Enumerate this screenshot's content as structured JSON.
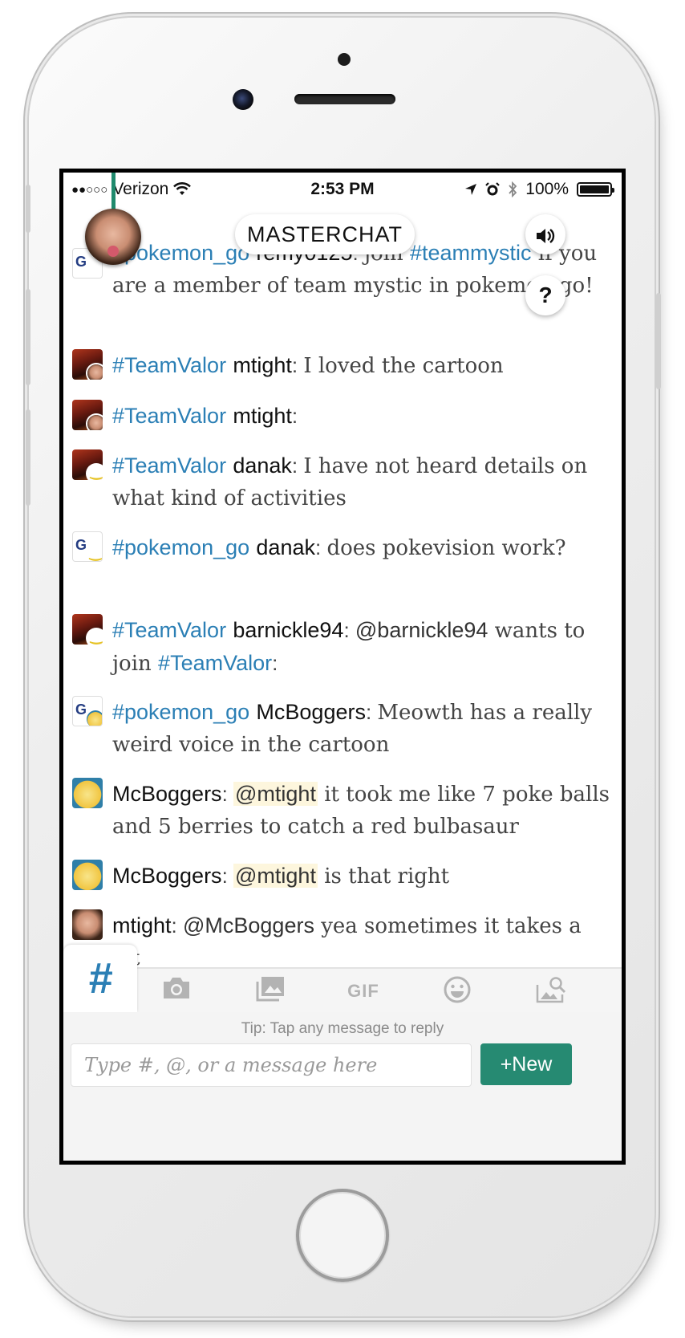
{
  "status_bar": {
    "signal": "●●○○○",
    "carrier": "Verizon",
    "time": "2:53 PM",
    "battery": "100%"
  },
  "header": {
    "title": "MASTERCHAT",
    "help_label": "?"
  },
  "messages": [
    {
      "channel": "#pokemon_go",
      "user": "remy0125",
      "colon": ": ",
      "text_pre": "join ",
      "inline_tag": "#teammystic",
      "text_post": " if you are a member of team mystic in pokemon go!"
    },
    {
      "channel": "#TeamValor",
      "user": "mtight",
      "colon": ": ",
      "text": "I loved the cartoon"
    },
    {
      "channel": "#TeamValor",
      "user": "mtight",
      "colon": ":",
      "text": ""
    },
    {
      "channel": "#TeamValor",
      "user": "danak",
      "colon": ": ",
      "text": "I have not heard details on what kind of activities"
    },
    {
      "channel": "#pokemon_go",
      "user": "danak",
      "colon": ": ",
      "text": "does pokevision work?"
    },
    {
      "channel": "#TeamValor",
      "user": "barnickle94",
      "colon": ": ",
      "mention": "@barnickle94",
      "text": " wants to join ",
      "inline_tag": "#TeamValor",
      "text_post": ":"
    },
    {
      "channel": "#pokemon_go",
      "user": "McBoggers",
      "colon": ": ",
      "text": "Meowth has a really weird voice in the cartoon"
    },
    {
      "user": "McBoggers",
      "colon": ": ",
      "mention": "@mtight",
      "text": " it took me like 7 poke balls and 5 berries to catch a red bulbasaur"
    },
    {
      "user": "McBoggers",
      "colon": ": ",
      "mention": "@mtight",
      "text": " is that right"
    },
    {
      "user": "mtight",
      "colon": ": ",
      "mention": "@McBoggers",
      "text": " yea sometimes it takes a lot"
    }
  ],
  "toolbar": {
    "hash_label": "#",
    "gif_label": "GIF",
    "icons": [
      "camera-icon",
      "gallery-icon",
      "gif-icon",
      "emoji-icon",
      "image-search-icon"
    ]
  },
  "composer": {
    "tip": "Tip: Tap any message to reply",
    "placeholder": "Type #, @, or a message here",
    "new_button": "+New"
  },
  "colors": {
    "accent": "#268a72",
    "hashtag": "#2b7fb5",
    "mention_highlight": "#fdf6dd"
  }
}
